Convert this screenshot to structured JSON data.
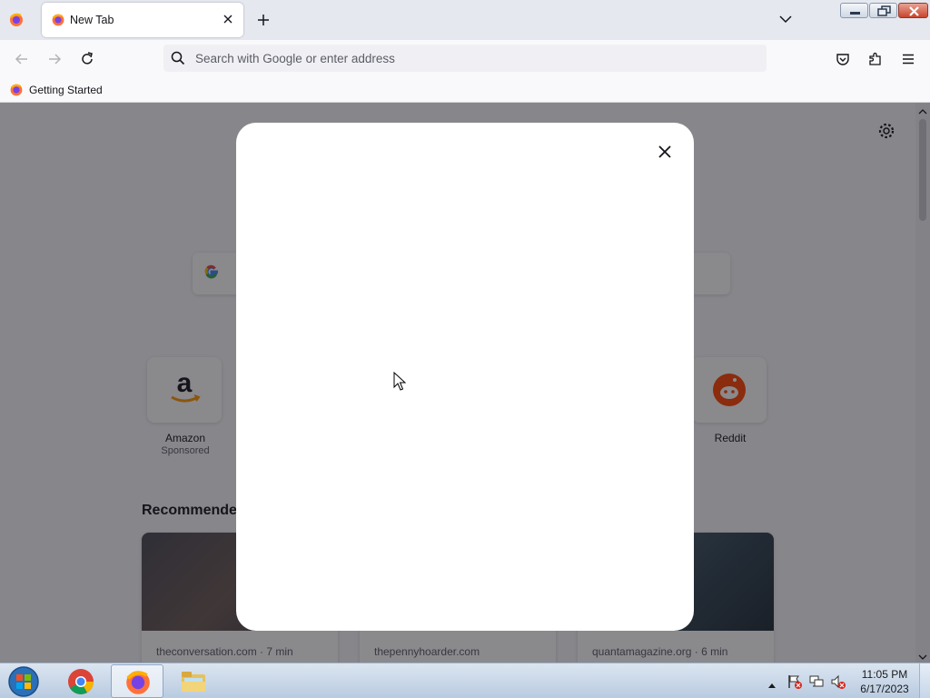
{
  "browser": {
    "tab": {
      "title": "New Tab"
    },
    "urlbar": {
      "placeholder": "Search with Google or enter address"
    },
    "bookmarks": [
      {
        "label": "Getting Started"
      }
    ]
  },
  "newtab": {
    "top_sites": [
      {
        "label": "Amazon",
        "sublabel": "Sponsored",
        "icon": "amazon-logo"
      },
      {
        "label": "Reddit",
        "sublabel": "",
        "icon": "reddit-logo"
      }
    ],
    "recommended_heading": "Recommende",
    "cards": [
      {
        "source": "theconversation.com · 7 min"
      },
      {
        "source": "thepennyhoarder.com"
      },
      {
        "source": "quantamagazine.org · 6 min"
      }
    ]
  },
  "taskbar": {
    "apps": [
      "windows-start",
      "google-chrome",
      "firefox",
      "windows-explorer"
    ],
    "clock_time": "11:05 PM",
    "clock_date": "6/17/2023"
  },
  "colors": {
    "firefox_orange": "#ff7139",
    "firefox_purple": "#7542e5",
    "overlay": "#15141a"
  }
}
